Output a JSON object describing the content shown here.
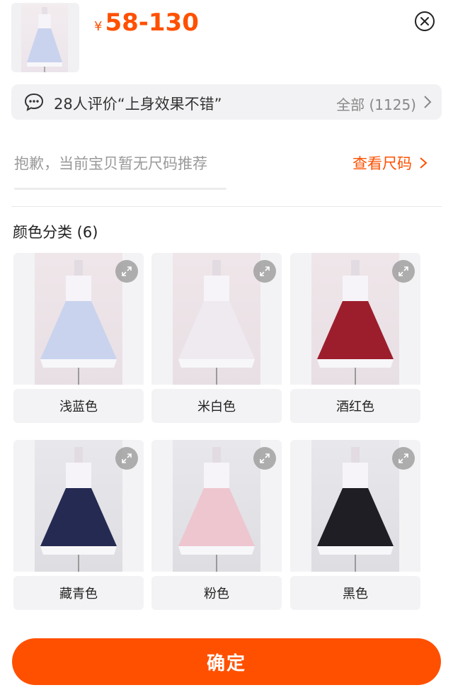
{
  "product": {
    "currency_symbol": "¥",
    "price_range": "58-130"
  },
  "review": {
    "summary": "28人评价“上身效果不错”",
    "all_label": "全部 (1125)"
  },
  "size": {
    "note": "抱歉，当前宝贝暂无尺码推荐",
    "link_label": "查看尺码"
  },
  "color_section": {
    "title": "颜色分类 (6)",
    "options": [
      {
        "label": "浅蓝色",
        "color": "#c9d3ee"
      },
      {
        "label": "米白色",
        "color": "#eeeaf0"
      },
      {
        "label": "酒红色",
        "color": "#9c1e2c"
      },
      {
        "label": "藏青色",
        "color": "#252a52"
      },
      {
        "label": "粉色",
        "color": "#eec6cf"
      },
      {
        "label": "黑色",
        "color": "#1e1e24"
      }
    ]
  },
  "footer": {
    "confirm_label": "确定"
  },
  "colors": {
    "accent": "#ff5000"
  }
}
